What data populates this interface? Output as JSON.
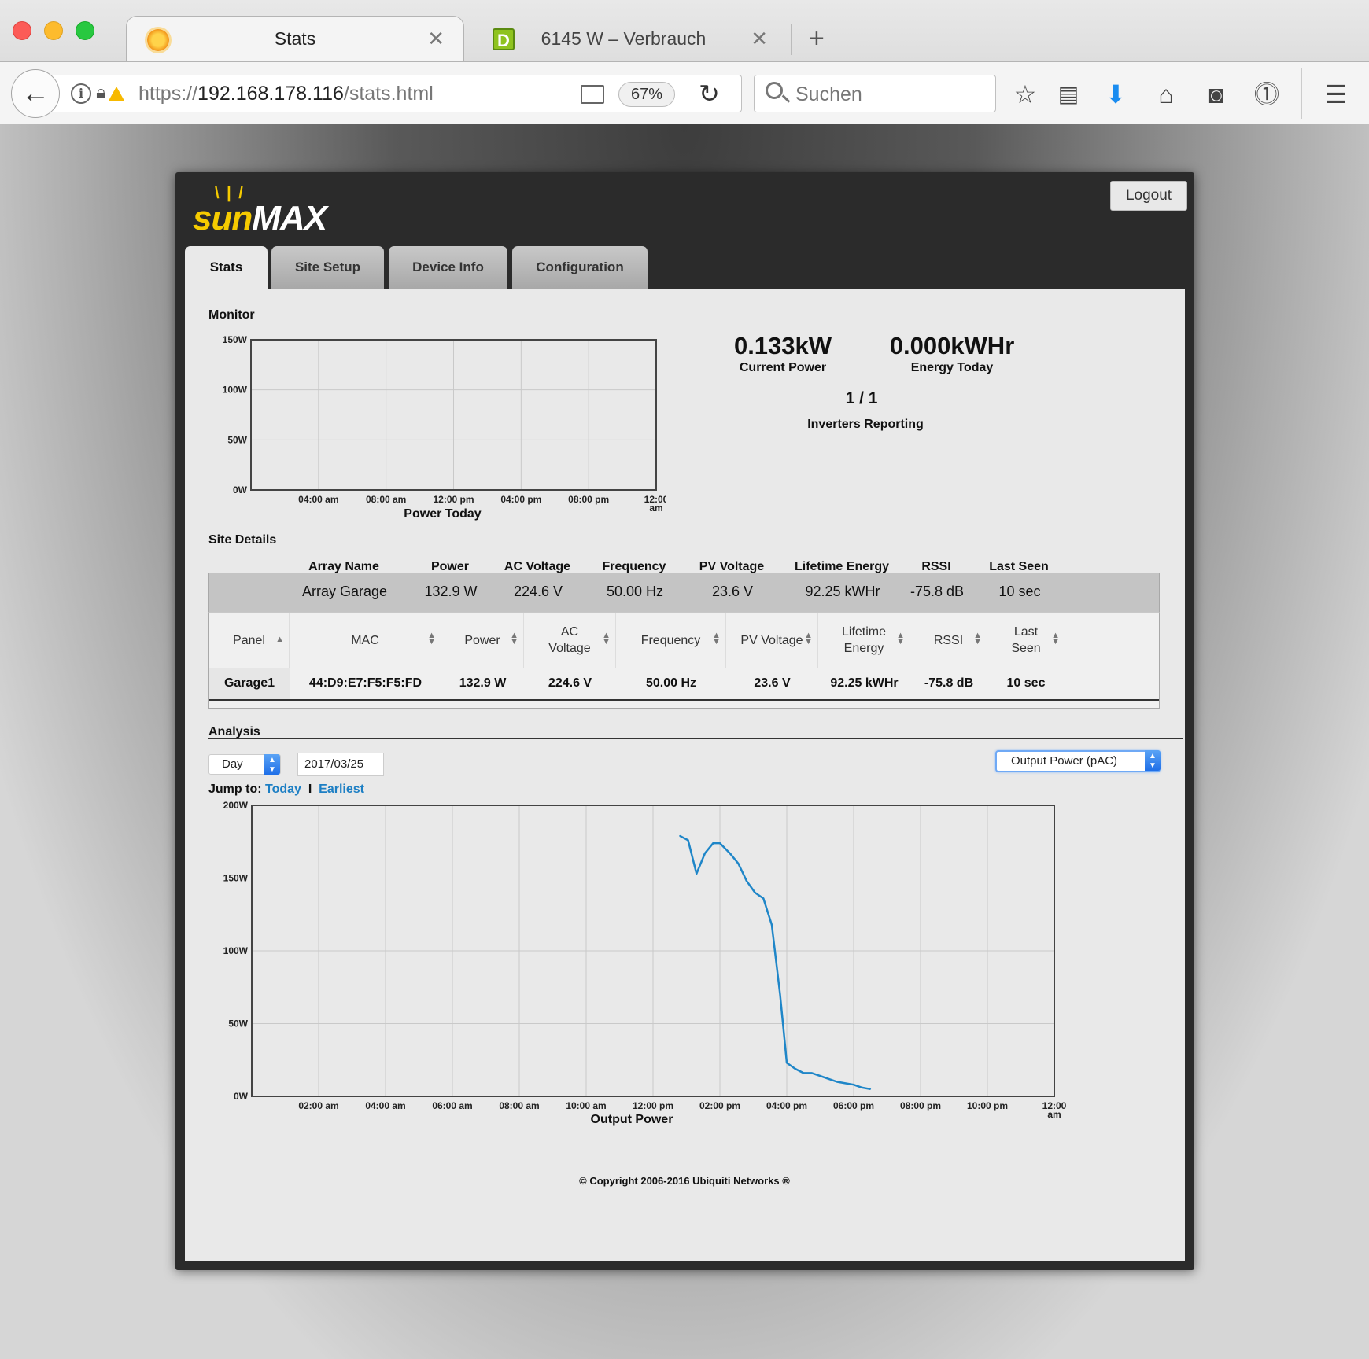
{
  "browser": {
    "tabs": [
      {
        "title": "Stats",
        "active": true,
        "icon": "sun-favicon-icon"
      },
      {
        "title": "6145 W – Verbrauch",
        "active": false,
        "icon": "d-favicon-icon"
      }
    ],
    "url_scheme": "https://",
    "url_host": "192.168.178.116",
    "url_path": "/stats.html",
    "zoom": "67%",
    "search_placeholder": "Suchen"
  },
  "app": {
    "logo_sun": "sun",
    "logo_max": "MAX",
    "logout_label": "Logout",
    "nav_tabs": [
      {
        "label": "Stats",
        "active": true
      },
      {
        "label": "Site Setup",
        "active": false
      },
      {
        "label": "Device Info",
        "active": false
      },
      {
        "label": "Configuration",
        "active": false
      }
    ]
  },
  "monitor": {
    "title": "Monitor",
    "current_power": "0.133kW",
    "current_power_label": "Current Power",
    "energy_today": "0.000kWHr",
    "energy_today_label": "Energy Today",
    "inverters": "1 / 1",
    "inverters_label": "Inverters Reporting"
  },
  "site_details": {
    "title": "Site Details",
    "headers": [
      "Array Name",
      "Power",
      "AC Voltage",
      "Frequency",
      "PV Voltage",
      "Lifetime Energy",
      "RSSI",
      "Last Seen"
    ],
    "array": [
      "Array Garage",
      "132.9 W",
      "224.6 V",
      "50.00 Hz",
      "23.6 V",
      "92.25 kWHr",
      "-75.8 dB",
      "10 sec"
    ],
    "panel_headers": [
      "Panel",
      "MAC",
      "Power",
      "AC\nVoltage",
      "Frequency",
      "PV Voltage",
      "Lifetime\nEnergy",
      "RSSI",
      "Last\nSeen"
    ],
    "panel_rows": [
      [
        "Garage1",
        "44:D9:E7:F5:F5:FD",
        "132.9 W",
        "224.6 V",
        "50.00 Hz",
        "23.6 V",
        "92.25 kWHr",
        "-75.8 dB",
        "10 sec"
      ]
    ]
  },
  "analysis": {
    "title": "Analysis",
    "period": "Day",
    "date": "2017/03/25",
    "metric": "Output Power (pAC)",
    "jump_label": "Jump to:",
    "jump_today": "Today",
    "jump_sep": "I",
    "jump_earliest": "Earliest"
  },
  "chart_data": [
    {
      "type": "line",
      "title": "Power Today",
      "ylim": [
        0,
        150
      ],
      "y_ticks": [
        "150W",
        "100W",
        "50W",
        "0W"
      ],
      "x_ticks": [
        "04:00 am",
        "08:00 am",
        "12:00 pm",
        "04:00 pm",
        "08:00 pm",
        "12:00 am"
      ],
      "xlim_hours": [
        0,
        24
      ],
      "grid": true,
      "series": [
        {
          "values": []
        }
      ]
    },
    {
      "type": "line",
      "title": "Output Power",
      "ylim": [
        0,
        200
      ],
      "y_ticks": [
        "200W",
        "150W",
        "100W",
        "50W",
        "0W"
      ],
      "x_ticks": [
        "02:00 am",
        "04:00 am",
        "06:00 am",
        "08:00 am",
        "10:00 am",
        "12:00 pm",
        "02:00 pm",
        "04:00 pm",
        "06:00 pm",
        "08:00 pm",
        "10:00 pm",
        "12:00 am"
      ],
      "xlim_hours": [
        0,
        24
      ],
      "grid": true,
      "color": "#1f86c8",
      "series": [
        {
          "x_hours": [
            12.8,
            13.05,
            13.3,
            13.55,
            13.8,
            14.0,
            14.3,
            14.55,
            14.8,
            15.05,
            15.3,
            15.55,
            15.8,
            16.0,
            16.25,
            16.5,
            16.75,
            17.0,
            17.25,
            17.5,
            17.75,
            18.0,
            18.25,
            18.5
          ],
          "values": [
            179,
            176,
            153,
            167,
            174,
            174,
            167,
            160,
            148,
            140,
            136,
            118,
            70,
            23,
            19,
            16,
            16,
            14,
            12,
            10,
            9,
            8,
            6,
            5
          ]
        }
      ]
    }
  ],
  "footer": {
    "copyright": "© Copyright 2006-2016 Ubiquiti Networks ®"
  }
}
